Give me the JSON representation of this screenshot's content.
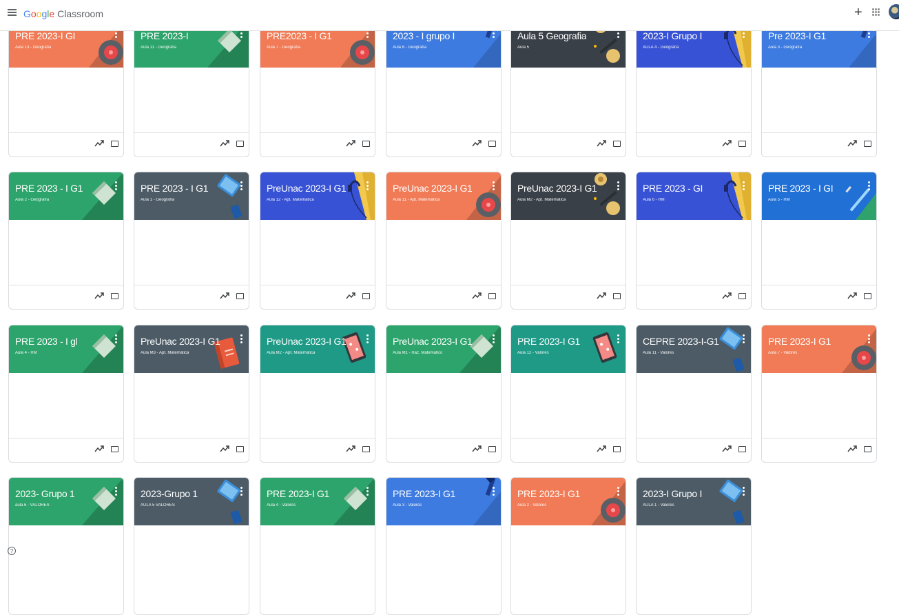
{
  "app": {
    "brand_google": "Google",
    "brand_product": "Classroom",
    "plus_label": "+",
    "help_label": "?"
  },
  "colors": {
    "orange": "#f07b56",
    "green": "#2da46b",
    "blue": "#3d7be0",
    "dark": "#3a4047",
    "indigo": "#3752d4",
    "teal": "#1e9a86",
    "slate": "#4c5b66",
    "sky": "#2170d6"
  },
  "courses": [
    {
      "title": "PRE 2023-I GI",
      "subtitle": "Aula 13 - Geografía",
      "color": "orange",
      "illustration": "disc-icon"
    },
    {
      "title": "PRE 2023-I",
      "subtitle": "Aula 11 - Geografía",
      "color": "green",
      "illustration": "book-icon"
    },
    {
      "title": "PRE2023 - I G1",
      "subtitle": "Aula 7 - Geografía",
      "color": "orange",
      "illustration": "disc-icon"
    },
    {
      "title": "2023 - I grupo I",
      "subtitle": "Aula 8 - Geografía",
      "color": "blue",
      "illustration": "pen-icon"
    },
    {
      "title": "Aula 5 Geografia",
      "subtitle": "Aula 5",
      "color": "dark",
      "illustration": "lamp-icon"
    },
    {
      "title": "2023-I Grupo I",
      "subtitle": "AULA 4 - Geografía",
      "color": "indigo",
      "illustration": "headphones-icon"
    },
    {
      "title": "Pre 2023-I G1",
      "subtitle": "Aula 3 - Geografía",
      "color": "blue",
      "illustration": "pen-icon"
    },
    {
      "title": "PRE 2023 - I G1",
      "subtitle": "Aula 2 - Geografía",
      "color": "green",
      "illustration": "book-icon"
    },
    {
      "title": "PRE 2023 - I G1",
      "subtitle": "Aula 1 - Geografía",
      "color": "slate",
      "illustration": "tablet-icon"
    },
    {
      "title": "PreUnac 2023-I G1",
      "subtitle": "Aula 12 - Apt. Matemática",
      "color": "indigo",
      "illustration": "headphones-icon"
    },
    {
      "title": "PreUnac 2023-I G1",
      "subtitle": "Aula 11 - Apt. Matemática",
      "color": "orange",
      "illustration": "disc-icon"
    },
    {
      "title": "PreUnac 2023-I G1",
      "subtitle": "Aula M2 - Apt. Matemática",
      "color": "dark",
      "illustration": "lamp-icon"
    },
    {
      "title": "PRE 2023 - GI",
      "subtitle": "Aula 6 - RM",
      "color": "indigo",
      "illustration": "headphones-icon"
    },
    {
      "title": "PRE 2023 - I GI",
      "subtitle": "Aula 5 - RM",
      "color": "sky",
      "illustration": "pencil-icon"
    },
    {
      "title": "PRE 2023 - I gl",
      "subtitle": "Aula 4 - RM",
      "color": "green",
      "illustration": "book-icon"
    },
    {
      "title": "PreUnac 2023-I G1",
      "subtitle": "Aula M3 - Apt. Matemática",
      "color": "slate",
      "illustration": "notebook-icon"
    },
    {
      "title": "PreUnac 2023-I G1",
      "subtitle": "Aula M2 - Apt. Matemática",
      "color": "teal",
      "illustration": "phone-icon"
    },
    {
      "title": "PreUnac 2023-I G1",
      "subtitle": "Aula M1 - Raz. Matemático",
      "color": "green",
      "illustration": "book-icon"
    },
    {
      "title": "PRE 2023-I G1",
      "subtitle": "Aula 12 - Valores",
      "color": "teal",
      "illustration": "phone-icon"
    },
    {
      "title": "CEPRE 2023-I-G1",
      "subtitle": "Aula 11 - Valores",
      "color": "slate",
      "illustration": "tablet-icon"
    },
    {
      "title": "PRE 2023-I G1",
      "subtitle": "Aula 7 - Valores",
      "color": "orange",
      "illustration": "disc-icon"
    },
    {
      "title": "2023- Grupo 1",
      "subtitle": "aula 6 - VALORES",
      "color": "green",
      "illustration": "book-icon"
    },
    {
      "title": "2023-Grupo 1",
      "subtitle": "AULA 5 VALORES",
      "color": "slate",
      "illustration": "tablet-icon"
    },
    {
      "title": "PRE 2023-I G1",
      "subtitle": "Aula 4 - Valores",
      "color": "green",
      "illustration": "book-icon"
    },
    {
      "title": "PRE 2023-I G1",
      "subtitle": "Aula 3 - Valores",
      "color": "blue",
      "illustration": "pen-icon"
    },
    {
      "title": "PRE 2023-I G1",
      "subtitle": "Aula 2 - Valores",
      "color": "orange",
      "illustration": "disc-icon"
    },
    {
      "title": "2023-I Grupo I",
      "subtitle": "AULA 1 - Valores",
      "color": "slate",
      "illustration": "tablet-icon"
    }
  ]
}
